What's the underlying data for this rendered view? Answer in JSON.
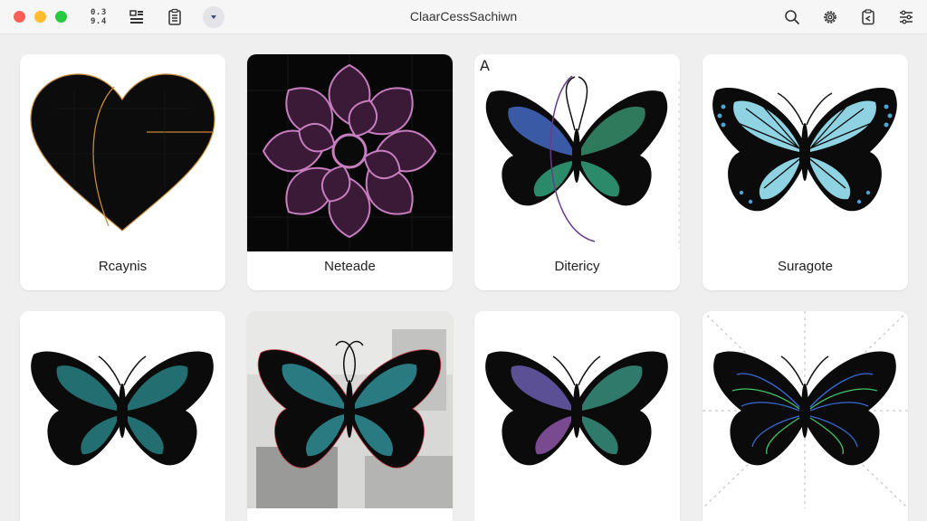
{
  "window": {
    "title": "ClaarCessSachiwn",
    "counter_line1": "0.3",
    "counter_line2": "9.4"
  },
  "toolbar": {
    "left_icons": [
      "layout-counter-icon",
      "grid-layout-icon",
      "document-list-icon",
      "play-icon"
    ],
    "right_icons": [
      "search-icon",
      "settings-icon",
      "clipboard-icon",
      "sliders-icon"
    ]
  },
  "gallery": {
    "row1": [
      {
        "label": "Rcaynis",
        "image": "black-heart"
      },
      {
        "label": "Neteade",
        "image": "pink-flower-on-black"
      },
      {
        "label": "Ditericy",
        "image": "teal-blue-butterfly",
        "annotation": "A"
      },
      {
        "label": "Suragote",
        "image": "light-blue-butterfly"
      }
    ],
    "row2": [
      {
        "image": "teal-butterfly"
      },
      {
        "image": "teal-butterfly-on-photo"
      },
      {
        "image": "purple-teal-butterfly"
      },
      {
        "image": "neon-line-butterfly"
      }
    ]
  },
  "colors": {
    "close": "#fe5f57",
    "minimize": "#febc2e",
    "maximize": "#28c840",
    "card_bg": "#ffffff",
    "window_bg": "#efefef"
  }
}
